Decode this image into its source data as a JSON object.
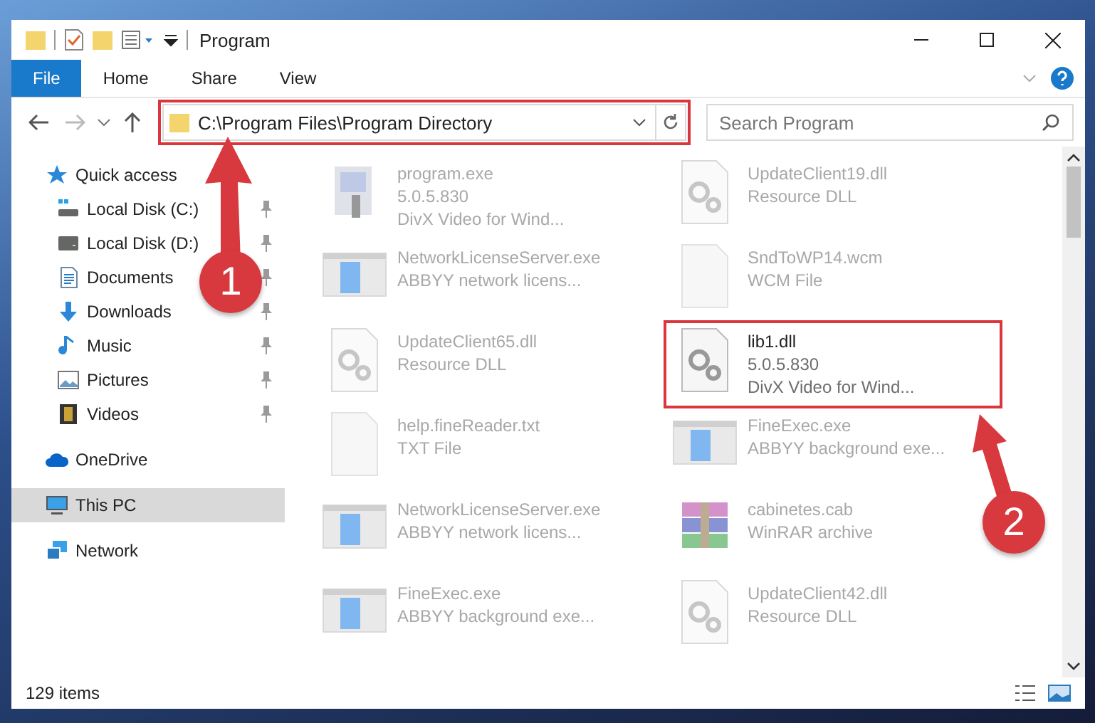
{
  "window": {
    "title": "Program"
  },
  "ribbon_tabs": [
    {
      "label": "File",
      "selected": true
    },
    {
      "label": "Home",
      "selected": false
    },
    {
      "label": "Share",
      "selected": false
    },
    {
      "label": "View",
      "selected": false
    }
  ],
  "address_bar": {
    "path": "C:\\Program Files\\Program Directory",
    "highlighted": true
  },
  "search": {
    "placeholder": "Search Program"
  },
  "navigation": [
    {
      "label": "Quick access",
      "kind": "star",
      "selected": false,
      "children": [
        {
          "label": "Local Disk (C:)",
          "kind": "system-drive",
          "pinned": true,
          "selected": false
        },
        {
          "label": "Local Disk (D:)",
          "kind": "drive",
          "pinned": true,
          "selected": false
        },
        {
          "label": "Documents",
          "kind": "documents",
          "pinned": true,
          "selected": false
        },
        {
          "label": "Downloads",
          "kind": "downloads",
          "pinned": true,
          "selected": false
        },
        {
          "label": "Music",
          "kind": "music",
          "pinned": true,
          "selected": false
        },
        {
          "label": "Pictures",
          "kind": "pictures",
          "pinned": true,
          "selected": false
        },
        {
          "label": "Videos",
          "kind": "videos",
          "pinned": true,
          "selected": false
        }
      ]
    },
    {
      "label": "OneDrive",
      "kind": "cloud",
      "selected": false
    },
    {
      "label": "This PC",
      "kind": "pc",
      "selected": true
    },
    {
      "label": "Network",
      "kind": "network",
      "selected": false
    }
  ],
  "files": [
    {
      "name": "program.exe",
      "details": [
        "5.0.5.830",
        "DivX Video for Wind..."
      ],
      "kind": "installer",
      "blurred": true,
      "highlighted": false
    },
    {
      "name": "UpdateClient19.dll",
      "details": [
        "Resource DLL"
      ],
      "kind": "dll",
      "blurred": true,
      "highlighted": false
    },
    {
      "name": "NetworkLicenseServer.exe",
      "details": [
        "ABBYY network licens..."
      ],
      "kind": "exe",
      "blurred": true,
      "highlighted": false
    },
    {
      "name": "SndToWP14.wcm",
      "details": [
        "WCM File"
      ],
      "kind": "blank",
      "blurred": true,
      "highlighted": false
    },
    {
      "name": "UpdateClient65.dll",
      "details": [
        "Resource DLL"
      ],
      "kind": "dll",
      "blurred": true,
      "highlighted": false
    },
    {
      "name": "lib1.dll",
      "details": [
        "5.0.5.830",
        "DivX Video for Wind..."
      ],
      "kind": "dll",
      "blurred": false,
      "highlighted": true
    },
    {
      "name": "help.fineReader.txt",
      "details": [
        "TXT File"
      ],
      "kind": "blank",
      "blurred": true,
      "highlighted": false
    },
    {
      "name": "FineExec.exe",
      "details": [
        "ABBYY background exe..."
      ],
      "kind": "exe",
      "blurred": true,
      "highlighted": false
    },
    {
      "name": "NetworkLicenseServer.exe",
      "details": [
        "ABBYY network licens..."
      ],
      "kind": "exe",
      "blurred": true,
      "highlighted": false
    },
    {
      "name": "cabinetes.cab",
      "details": [
        "WinRAR archive"
      ],
      "kind": "archive",
      "blurred": true,
      "highlighted": false
    },
    {
      "name": "FineExec.exe",
      "details": [
        "ABBYY background exe..."
      ],
      "kind": "exe",
      "blurred": true,
      "highlighted": false
    },
    {
      "name": "UpdateClient42.dll",
      "details": [
        "Resource DLL"
      ],
      "kind": "dll",
      "blurred": true,
      "highlighted": false
    }
  ],
  "status_bar": {
    "item_count": "129 items"
  },
  "annotations": [
    {
      "label": "1"
    },
    {
      "label": "2"
    }
  ]
}
